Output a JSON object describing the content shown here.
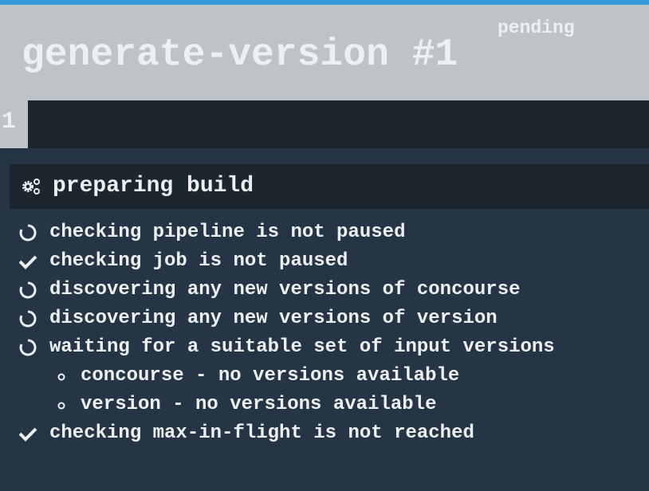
{
  "header": {
    "title": "generate-version #1",
    "status": "pending"
  },
  "tabs": [
    {
      "label": "1"
    }
  ],
  "step": {
    "title": "preparing build",
    "icon": "gears-icon"
  },
  "items": [
    {
      "icon": "spinner-icon",
      "text": "checking pipeline is not paused"
    },
    {
      "icon": "check-icon",
      "text": "checking job is not paused"
    },
    {
      "icon": "spinner-icon",
      "text": "discovering any new versions of concourse"
    },
    {
      "icon": "spinner-icon",
      "text": "discovering any new versions of version"
    },
    {
      "icon": "spinner-icon",
      "text": "waiting for a suitable set of input versions"
    },
    {
      "icon": "bullet-icon",
      "text": "concourse - no versions available",
      "sub": true
    },
    {
      "icon": "bullet-icon",
      "text": "version - no versions available",
      "sub": true
    },
    {
      "icon": "check-icon",
      "text": "checking max-in-flight is not reached"
    }
  ],
  "colors": {
    "accent": "#3498db",
    "header": "#bdc3c7",
    "panel": "#1b262f",
    "body": "#253545",
    "text": "#ecf0f1"
  }
}
